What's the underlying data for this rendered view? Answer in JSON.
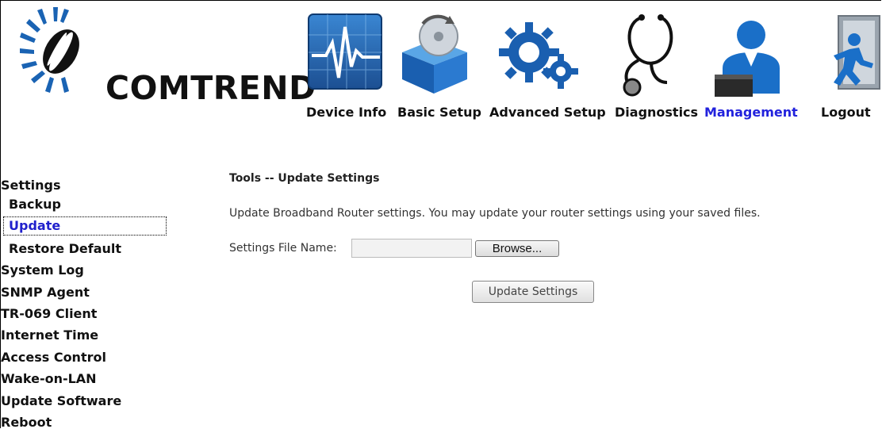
{
  "brand": {
    "name": "COMTREND"
  },
  "topnav": {
    "items": [
      {
        "label": "Device Info",
        "icon": "device-info-icon"
      },
      {
        "label": "Basic Setup",
        "icon": "basic-setup-icon"
      },
      {
        "label": "Advanced Setup",
        "icon": "advanced-setup-icon"
      },
      {
        "label": "Diagnostics",
        "icon": "stethoscope-icon"
      },
      {
        "label": "Management",
        "icon": "management-icon",
        "active": true
      },
      {
        "label": "Logout",
        "icon": "logout-icon"
      }
    ],
    "active_color": "#2222dd"
  },
  "sidebar": {
    "items": [
      {
        "label": "Settings"
      },
      {
        "label": "Backup"
      },
      {
        "label": "Update",
        "selected": true
      },
      {
        "label": "Restore Default"
      },
      {
        "label": "System Log"
      },
      {
        "label": "SNMP Agent"
      },
      {
        "label": "TR-069 Client"
      },
      {
        "label": "Internet Time"
      },
      {
        "label": "Access Control"
      },
      {
        "label": "Wake-on-LAN"
      },
      {
        "label": "Update Software"
      },
      {
        "label": "Reboot"
      }
    ]
  },
  "main": {
    "title": "Tools -- Update Settings",
    "description": "Update Broadband Router settings. You may update your router settings using your saved files.",
    "file_label": "Settings File Name:",
    "file_value": "",
    "browse_label": "Browse...",
    "submit_label": "Update Settings"
  }
}
